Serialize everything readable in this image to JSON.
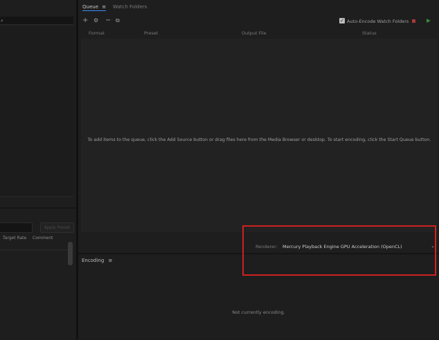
{
  "queue_panel": {
    "tabs": [
      {
        "label": "Queue",
        "menu_icon": "≡"
      },
      {
        "label": "Watch Folders"
      }
    ],
    "toolbar": {
      "add_icon": "+",
      "settings_icon": "⚙",
      "remove_icon": "−",
      "duplicate_icon": "⧉",
      "auto_encode_label": "Auto-Encode Watch Folders",
      "auto_encode_checked": true,
      "stop_color": "#a83a3a",
      "start_color": "#3a8a3a"
    },
    "columns": [
      "Format",
      "Preset",
      "Output File",
      "Status"
    ],
    "empty_message": "To add items to the queue, click the Add Source button or drag files here from the Media Browser or desktop.  To start encoding, click the Start Queue button.",
    "renderer_label": "Renderer:",
    "renderer_value": "Mercury Playback Engine GPU Acceleration (OpenCL)"
  },
  "encoding_panel": {
    "title": "Encoding",
    "menu_icon": "≡",
    "status": "Not currently encoding."
  },
  "left_panel": {
    "apply_preset_label": "Apply Preset",
    "columns": [
      "Target Rate",
      "Comment"
    ]
  },
  "highlight_color": "#d12121"
}
